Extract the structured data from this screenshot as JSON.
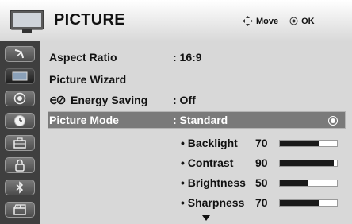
{
  "header": {
    "title": "PICTURE",
    "hint_move_icon": "dpad-arrows-icon",
    "hint_move": "Move",
    "hint_ok_icon": "ok-circle-icon",
    "hint_ok": "OK"
  },
  "sidebar": {
    "items": [
      {
        "icon": "satellite-dish-icon"
      },
      {
        "icon": "picture-icon",
        "active": true
      },
      {
        "icon": "speaker-audio-icon"
      },
      {
        "icon": "clock-time-icon"
      },
      {
        "icon": "toolbox-option-icon"
      },
      {
        "icon": "padlock-icon"
      },
      {
        "icon": "bluetooth-icon"
      },
      {
        "icon": "media-clapper-icon"
      }
    ]
  },
  "menu": {
    "aspect_ratio": {
      "label": "Aspect Ratio",
      "value": ": 16:9"
    },
    "picture_wizard": {
      "label": "Picture Wizard"
    },
    "energy_saving": {
      "icon": "eco-leaf-icon",
      "label": "Energy Saving",
      "value": ": Off"
    },
    "picture_mode": {
      "label": "Picture Mode",
      "value": ": Standard"
    }
  },
  "settings": [
    {
      "label": "• Backlight",
      "value": "70",
      "level": 0.7
    },
    {
      "label": "• Contrast",
      "value": "90",
      "level": 0.95
    },
    {
      "label": "• Brightness",
      "value": "50",
      "level": 0.5
    },
    {
      "label": "• Sharpness",
      "value": "70",
      "level": 0.7
    }
  ],
  "colors": {
    "highlight": "#7a7a7a",
    "sidebar": "#3f3f3f",
    "panel": "#d8d8d8"
  }
}
